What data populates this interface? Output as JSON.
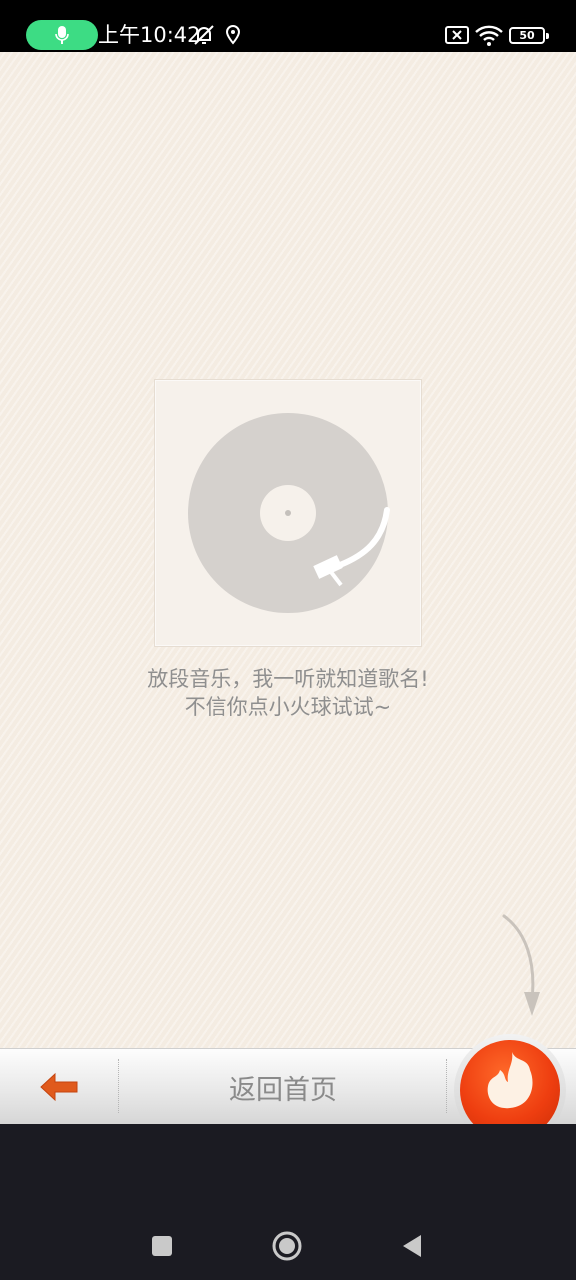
{
  "status_bar": {
    "time": "上午10:42",
    "battery": "50"
  },
  "main": {
    "hint_line1": "放段音乐，我一听就知道歌名!",
    "hint_line2": "不信你点小火球试试~"
  },
  "toolbar": {
    "home_label": "返回首页"
  },
  "colors": {
    "background": "#f4ece2",
    "accent": "#ee3e10",
    "back_arrow": "#e05a1c",
    "mic_pill": "#3ddc84"
  },
  "icons": [
    "mic-icon",
    "mute-bell-icon",
    "location-icon",
    "no-sim-icon",
    "wifi-icon",
    "battery-icon",
    "record-icon",
    "hint-arrow-icon",
    "back-arrow-icon",
    "fire-icon",
    "recents-icon",
    "home-icon",
    "back-icon"
  ]
}
